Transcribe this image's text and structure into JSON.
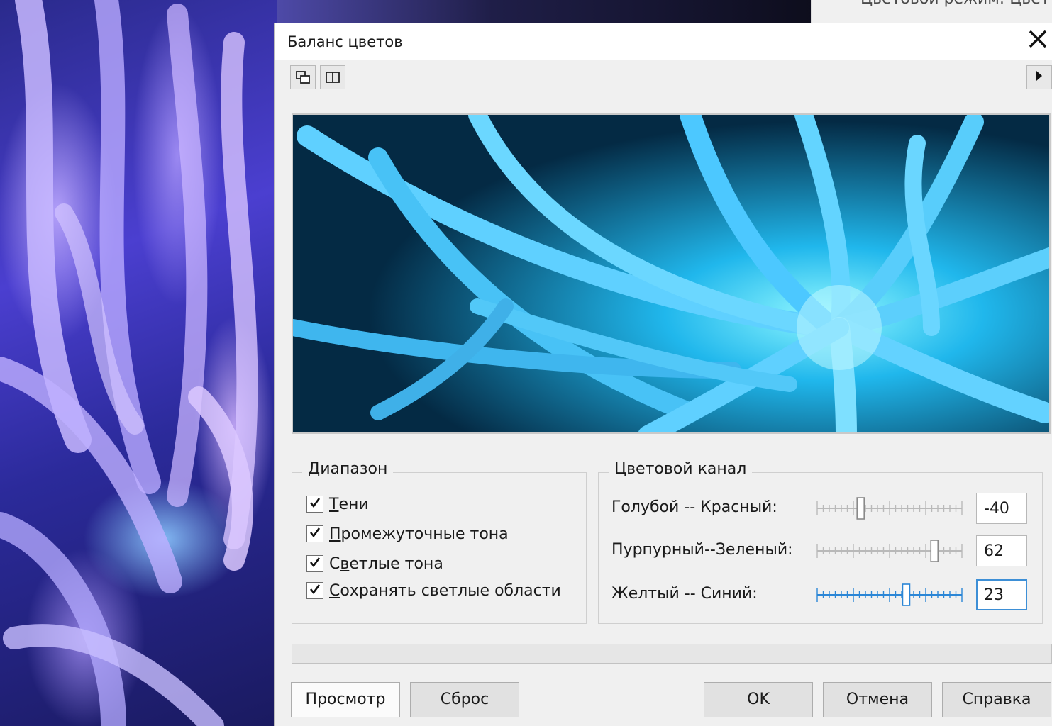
{
  "background": {
    "right_strip_text": "Цветовой режим: Цвет"
  },
  "dialog": {
    "title": "Баланс цветов",
    "close_glyph": "✕"
  },
  "toolbar": {
    "compare_icon": "two-panes-overlap-icon",
    "split_icon": "split-view-icon",
    "expand_icon": "play-right-icon"
  },
  "range": {
    "legend": "Диапазон",
    "items": [
      {
        "prefix": "",
        "ul": "Т",
        "rest": "ени",
        "checked": true
      },
      {
        "prefix": "",
        "ul": "П",
        "rest": "ромежуточные тона",
        "checked": true
      },
      {
        "prefix": "С",
        "ul": "в",
        "rest": "етлые тона",
        "checked": true
      },
      {
        "prefix": "",
        "ul": "С",
        "rest": "охранять светлые области",
        "checked": true
      }
    ]
  },
  "channel": {
    "legend": "Цветовой канал",
    "sliders": [
      {
        "label": "Голубой -- Красный:",
        "value": "-40",
        "min": -100,
        "max": 100,
        "active": false
      },
      {
        "label": "Пурпурный--Зеленый:",
        "value": "62",
        "min": -100,
        "max": 100,
        "active": false
      },
      {
        "label": "Желтый -- Синий:",
        "value": "23",
        "min": -100,
        "max": 100,
        "active": true
      }
    ]
  },
  "buttons": {
    "preview": "Просмотр",
    "reset": "Сброс",
    "ok": "OK",
    "cancel": "Отмена",
    "help": "Справка"
  },
  "colors": {
    "accent": "#3d8fd6",
    "slider_active": "#2b86d6",
    "slider_inactive": "#b9b9b9"
  }
}
